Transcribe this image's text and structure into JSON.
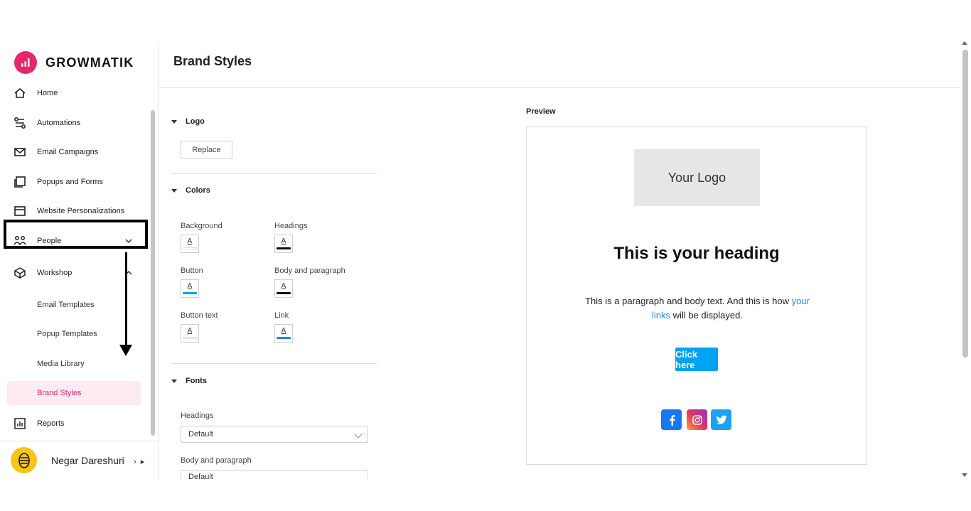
{
  "brand": {
    "name": "GROWMATIK",
    "accent": "#e8266d"
  },
  "sidebar": {
    "items": [
      {
        "label": "Home",
        "icon": "home-icon"
      },
      {
        "label": "Automations",
        "icon": "automation-icon"
      },
      {
        "label": "Email Campaigns",
        "icon": "mail-icon"
      },
      {
        "label": "Popups and Forms",
        "icon": "popup-icon"
      },
      {
        "label": "Website Personalizations",
        "icon": "browser-icon"
      },
      {
        "label": "People",
        "icon": "people-icon"
      },
      {
        "label": "Workshop",
        "icon": "box-icon"
      },
      {
        "label": "Reports",
        "icon": "chart-icon"
      }
    ],
    "workshop_sub": [
      "Email Templates",
      "Popup Templates",
      "Media Library",
      "Brand Styles"
    ],
    "active_sub": "Brand Styles"
  },
  "user": {
    "name": "Negar Dareshuri"
  },
  "page": {
    "title": "Brand Styles"
  },
  "settings": {
    "logo": {
      "title": "Logo",
      "replace_label": "Replace"
    },
    "colors": {
      "title": "Colors",
      "items": [
        {
          "label": "Background",
          "color": "#ffffff"
        },
        {
          "label": "Headings",
          "color": "#111111"
        },
        {
          "label": "Button",
          "color": "#00a2f3"
        },
        {
          "label": "Body and paragraph",
          "color": "#111111"
        },
        {
          "label": "Button text",
          "color": "#ffffff"
        },
        {
          "label": "Link",
          "color": "#1a8cdc"
        }
      ]
    },
    "fonts": {
      "title": "Fonts",
      "headings_label": "Headings",
      "headings_value": "Default",
      "body_label": "Body and paragraph",
      "body_value": "Default"
    }
  },
  "preview": {
    "label": "Preview",
    "logo_text": "Your Logo",
    "heading": "This is your heading",
    "para_before": "This is a paragraph and body text. And this is how",
    "para_link": "your links",
    "para_after": "will be displayed.",
    "button": "Click here",
    "social": [
      "facebook-icon",
      "instagram-icon",
      "twitter-icon"
    ]
  }
}
